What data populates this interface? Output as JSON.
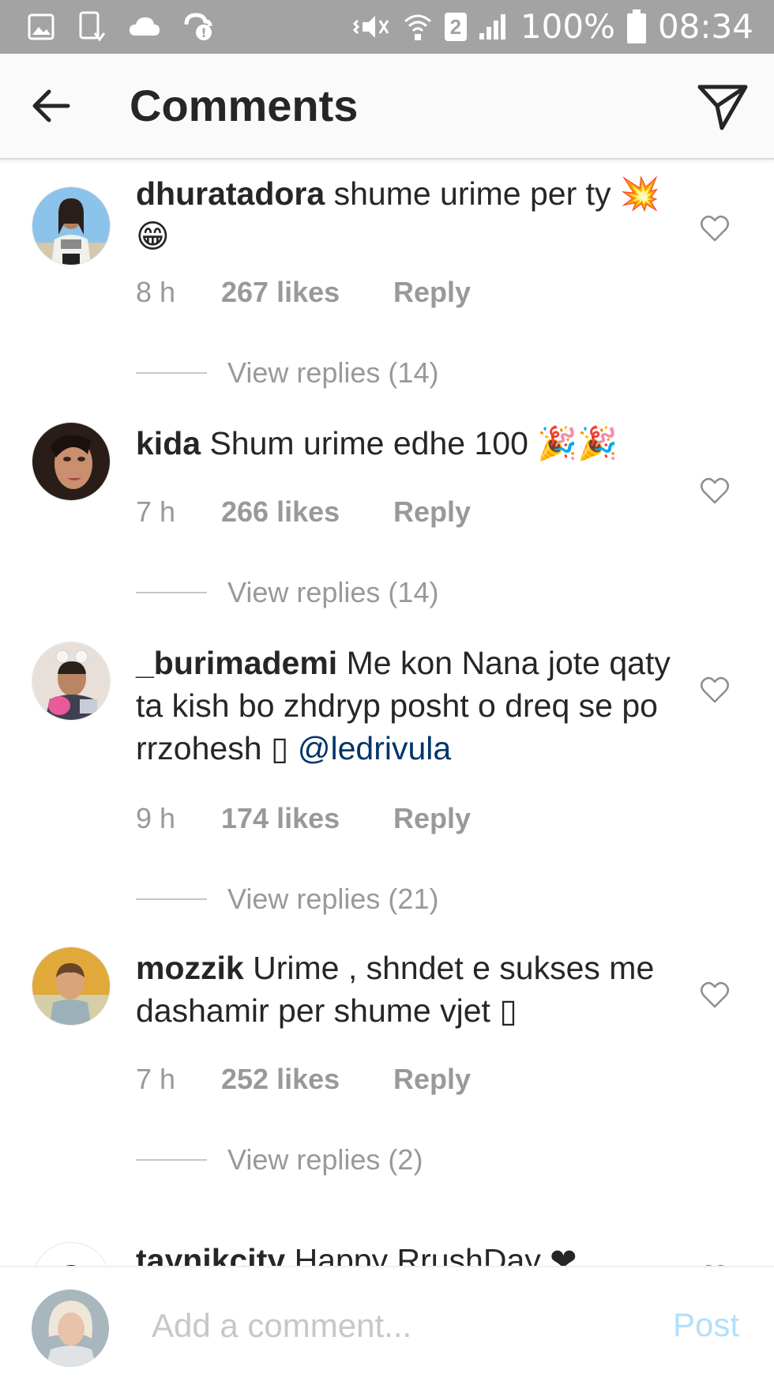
{
  "status_bar": {
    "icons_left": [
      "gallery-icon",
      "download-icon",
      "cloud-icon",
      "sync-icon"
    ],
    "icons_right": [
      "vibrate-icon",
      "wifi-icon",
      "signal-icon",
      "battery-icon"
    ],
    "sim": "2",
    "battery": "100%",
    "time": "08:34"
  },
  "header": {
    "title": "Comments"
  },
  "comments": [
    {
      "username": "dhuratadora",
      "text": "shume urime per ty",
      "emoji": "💥😁",
      "time": "8 h",
      "likes": "267 likes",
      "reply": "Reply",
      "view_replies": "View replies (14)"
    },
    {
      "username": "kida",
      "text": "Shum urime edhe 100",
      "emoji": "🎉🎉",
      "time": "7 h",
      "likes": "266 likes",
      "reply": "Reply",
      "view_replies": "View replies (14)"
    },
    {
      "username": "_burimademi",
      "text": "Me kon Nana jote qaty ta kish bo zhdryp posht o dreq se po rrzohesh ▯",
      "mention": "@ledrivula",
      "time": "9 h",
      "likes": "174 likes",
      "reply": "Reply",
      "view_replies": "View replies (21)"
    },
    {
      "username": "mozzik",
      "text": "Urime , shndet e sukses me dashamir per shume vjet ▯",
      "time": "7 h",
      "likes": "252 likes",
      "reply": "Reply",
      "view_replies": "View replies (2)"
    },
    {
      "username": "taynikcity",
      "text": "Happy RrushDay ❤"
    }
  ],
  "input": {
    "placeholder": "Add a comment...",
    "post_label": "Post"
  },
  "colors": {
    "status_bar": "#a3a3a3",
    "header_bg": "#fafafa",
    "text": "#262626",
    "meta": "#999999",
    "mention": "#003569",
    "post_disabled": "#b2dffc"
  }
}
